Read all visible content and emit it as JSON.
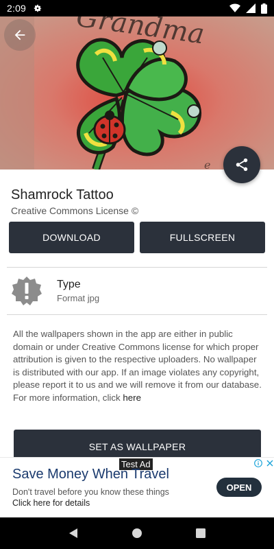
{
  "status_bar": {
    "time": "2:09",
    "icons": [
      "gear-icon",
      "wifi-icon",
      "signal-icon",
      "battery-icon"
    ]
  },
  "hero": {
    "caption_text": "Grandma",
    "subject": "shamrock tattoo with ladybug"
  },
  "wallpaper": {
    "title": "Shamrock Tattoo",
    "license": "Creative Commons License ©"
  },
  "actions": {
    "download_label": "DOWNLOAD",
    "fullscreen_label": "FULLSCREEN",
    "set_wallpaper_label": "SET AS WALLPAPER"
  },
  "details": {
    "type_label": "Type",
    "type_value": "Format jpg"
  },
  "disclaimer": {
    "text": "All the wallpapers shown in the app are either in public domain or under Creative Commons license for which proper attribution is given to the respective uploaders. No wallpaper is distributed with our app. If an image violates any copyright, please report it to us and we will remove it from our database. For more information, click",
    "link": "here"
  },
  "ad": {
    "badge": "Test Ad",
    "title": "Save Money When Travel",
    "description": "Don't travel before you know these things",
    "cta_text": "Click here for details",
    "button_label": "OPEN"
  },
  "colors": {
    "primary_dark": "#2b313b",
    "ad_title": "#1a3a6e",
    "shamrock_green": "#3aa63a"
  }
}
